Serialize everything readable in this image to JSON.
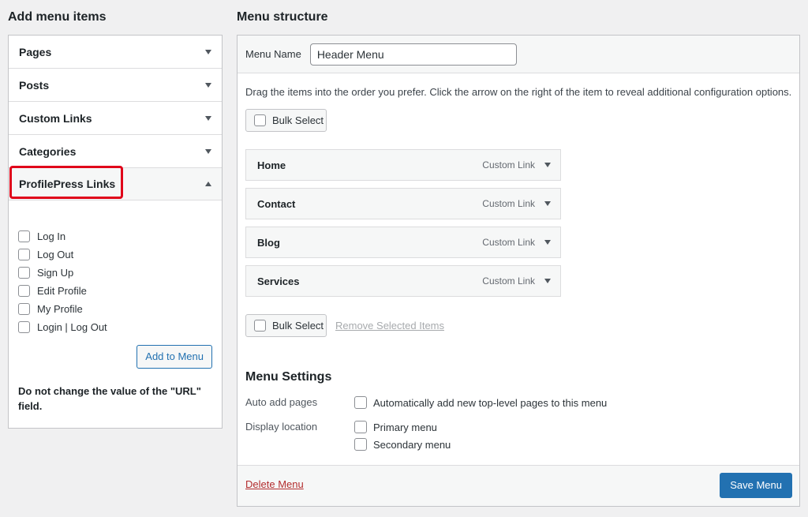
{
  "left": {
    "title": "Add menu items",
    "sections": [
      {
        "label": "Pages"
      },
      {
        "label": "Posts"
      },
      {
        "label": "Custom Links"
      },
      {
        "label": "Categories"
      },
      {
        "label": "ProfilePress Links"
      }
    ],
    "profilepress_options": [
      "Log In",
      "Log Out",
      "Sign Up",
      "Edit Profile",
      "My Profile",
      "Login | Log Out"
    ],
    "add_button": "Add to Menu",
    "note": "Do not change the value of the \"URL\" field."
  },
  "right": {
    "title": "Menu structure",
    "menu_name_label": "Menu Name",
    "menu_name_value": "Header Menu",
    "instructions": "Drag the items into the order you prefer. Click the arrow on the right of the item to reveal additional configuration options.",
    "bulk_select": "Bulk Select",
    "items": [
      {
        "label": "Home",
        "type": "Custom Link"
      },
      {
        "label": "Contact",
        "type": "Custom Link"
      },
      {
        "label": "Blog",
        "type": "Custom Link"
      },
      {
        "label": "Services",
        "type": "Custom Link"
      }
    ],
    "remove_selected": "Remove Selected Items",
    "settings": {
      "title": "Menu Settings",
      "auto_add_label": "Auto add pages",
      "auto_add_option": "Automatically add new top-level pages to this menu",
      "display_location_label": "Display location",
      "locations": [
        "Primary menu",
        "Secondary menu"
      ]
    },
    "delete_menu": "Delete Menu",
    "save_menu": "Save Menu"
  },
  "colors": {
    "accent": "#2271b1",
    "highlight": "#e0041a",
    "danger": "#b32d2e"
  }
}
